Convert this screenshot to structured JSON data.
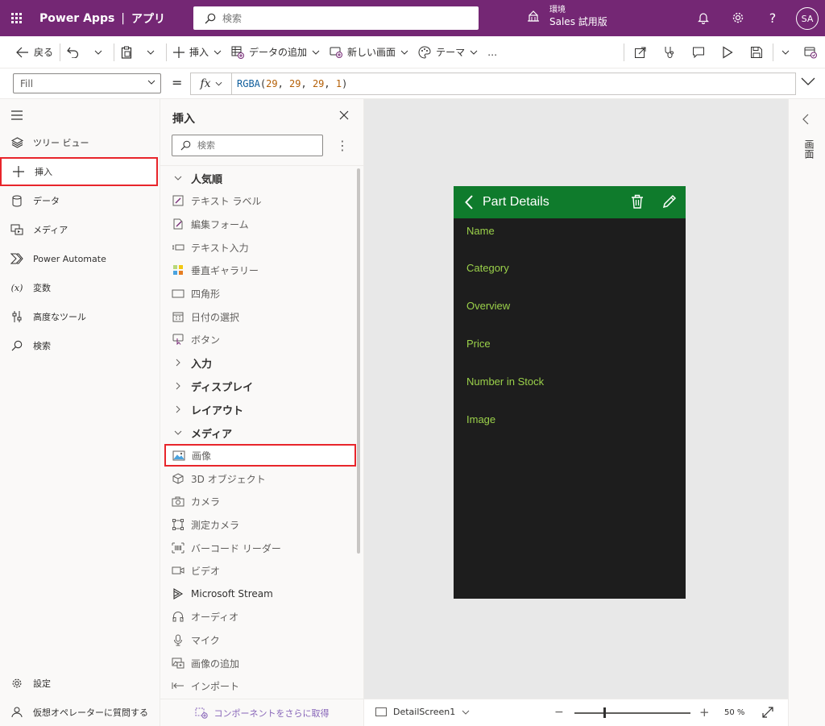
{
  "topbar": {
    "app_name": "Power Apps",
    "separator": "|",
    "app_kind": "アプリ",
    "search_placeholder": "検索",
    "env_label": "環境",
    "env_name": "Sales 試用版",
    "avatar_initials": "SA",
    "help_glyph": "?"
  },
  "commands": {
    "back": "戻る",
    "insert": "挿入",
    "add_data": "データの追加",
    "new_screen": "新しい画面",
    "theme": "テーマ",
    "more": "…"
  },
  "formula_bar": {
    "property": "Fill",
    "equals": "=",
    "fx": "fx",
    "fn": "RGBA",
    "open": "(",
    "arg1": "29",
    "comma1": ", ",
    "arg2": "29",
    "comma2": ", ",
    "arg3": "29",
    "comma3": ", ",
    "arg4": "1",
    "close": ")"
  },
  "left_nav": {
    "items": [
      {
        "label": "ツリー ビュー",
        "icon": "layers-icon"
      },
      {
        "label": "挿入",
        "icon": "plus-icon",
        "active": true
      },
      {
        "label": "データ",
        "icon": "database-icon"
      },
      {
        "label": "メディア",
        "icon": "media-icon"
      },
      {
        "label": "Power Automate",
        "icon": "power-automate-icon"
      },
      {
        "label": "変数",
        "icon": "variable-icon"
      },
      {
        "label": "高度なツール",
        "icon": "tools-icon"
      },
      {
        "label": "検索",
        "icon": "search-icon"
      }
    ],
    "bottom": [
      {
        "label": "設定",
        "icon": "gear-icon"
      },
      {
        "label": "仮想オペレーターに質問する",
        "icon": "agent-icon"
      }
    ]
  },
  "insert_panel": {
    "title": "挿入",
    "search_placeholder": "検索",
    "rows": [
      {
        "label": "人気順",
        "type": "category",
        "expanded": true
      },
      {
        "label": "テキスト ラベル",
        "icon": "text-label-icon"
      },
      {
        "label": "編集フォーム",
        "icon": "edit-form-icon"
      },
      {
        "label": "テキスト入力",
        "icon": "text-input-icon"
      },
      {
        "label": "垂直ギャラリー",
        "icon": "gallery-icon"
      },
      {
        "label": "四角形",
        "icon": "rectangle-icon"
      },
      {
        "label": "日付の選択",
        "icon": "calendar-icon"
      },
      {
        "label": "ボタン",
        "icon": "button-icon"
      },
      {
        "label": "入力",
        "type": "category",
        "expanded": false
      },
      {
        "label": "ディスプレイ",
        "type": "category",
        "expanded": false
      },
      {
        "label": "レイアウト",
        "type": "category",
        "expanded": false
      },
      {
        "label": "メディア",
        "type": "category",
        "expanded": true
      },
      {
        "label": "画像",
        "icon": "image-icon",
        "highlight": true
      },
      {
        "label": "3D オブジェクト",
        "icon": "cube-icon"
      },
      {
        "label": "カメラ",
        "icon": "camera-icon"
      },
      {
        "label": "測定カメラ",
        "icon": "measure-icon"
      },
      {
        "label": "バーコード リーダー",
        "icon": "barcode-icon"
      },
      {
        "label": "ビデオ",
        "icon": "video-icon"
      },
      {
        "label": "Microsoft Stream",
        "icon": "stream-icon"
      },
      {
        "label": "オーディオ",
        "icon": "headphones-icon"
      },
      {
        "label": "マイク",
        "icon": "microphone-icon"
      },
      {
        "label": "画像の追加",
        "icon": "add-image-icon"
      },
      {
        "label": "インポート",
        "icon": "import-icon"
      }
    ],
    "footer": "コンポーネントをさらに取得"
  },
  "app_preview": {
    "header_title": "Part Details",
    "header_color": "#0f7b2c",
    "background": "#1d1d1d",
    "field_color": "#9bd14a",
    "fields": [
      "Name",
      "Category",
      "Overview",
      "Price",
      "Number in Stock",
      "Image"
    ]
  },
  "right_rail": {
    "label": "画面"
  },
  "status_bar": {
    "screen_name": "DetailScreen1",
    "zoom_value": "50",
    "zoom_unit": "%",
    "zoom_fraction": 0.25
  }
}
